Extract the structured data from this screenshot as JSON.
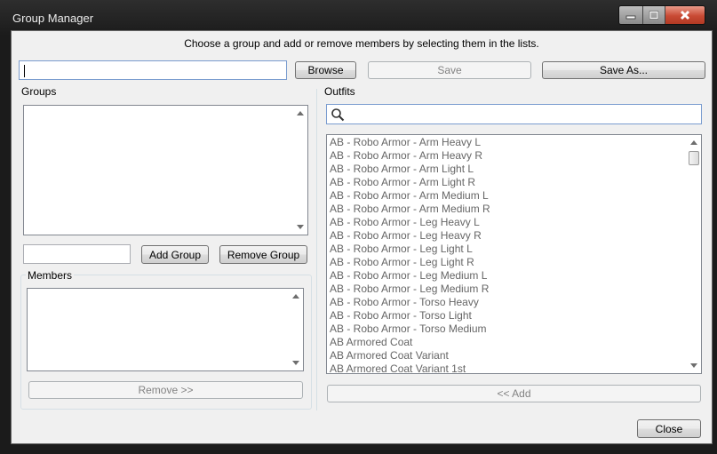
{
  "window": {
    "title": "Group Manager"
  },
  "instruction": "Choose a group and add or remove members by selecting them in the lists.",
  "toolbar": {
    "path_value": "",
    "browse_label": "Browse",
    "save_label": "Save",
    "save_as_label": "Save As..."
  },
  "groups": {
    "label": "Groups",
    "items": [],
    "new_group_value": "",
    "add_group_label": "Add Group",
    "remove_group_label": "Remove Group"
  },
  "members": {
    "label": "Members",
    "items": [],
    "remove_label": "Remove >>"
  },
  "outfits": {
    "label": "Outfits",
    "search_value": "",
    "items": [
      "AB - Robo Armor - Arm Heavy L",
      "AB - Robo Armor - Arm Heavy R",
      "AB - Robo Armor - Arm Light L",
      "AB - Robo Armor - Arm Light R",
      "AB - Robo Armor - Arm Medium L",
      "AB - Robo Armor - Arm Medium R",
      "AB - Robo Armor - Leg Heavy L",
      "AB - Robo Armor - Leg Heavy R",
      "AB - Robo Armor - Leg Light L",
      "AB - Robo Armor - Leg Light R",
      "AB - Robo Armor - Leg Medium L",
      "AB - Robo Armor - Leg Medium R",
      "AB - Robo Armor - Torso Heavy",
      "AB - Robo Armor - Torso Light",
      "AB - Robo Armor - Torso Medium",
      "AB Armored Coat",
      "AB Armored Coat Variant",
      "AB Armored Coat Variant 1st"
    ],
    "add_label": "<< Add"
  },
  "footer": {
    "close_label": "Close"
  },
  "icons": {
    "search": "search-icon",
    "minimize": "minimize-icon",
    "maximize": "maximize-icon",
    "close": "close-icon"
  }
}
